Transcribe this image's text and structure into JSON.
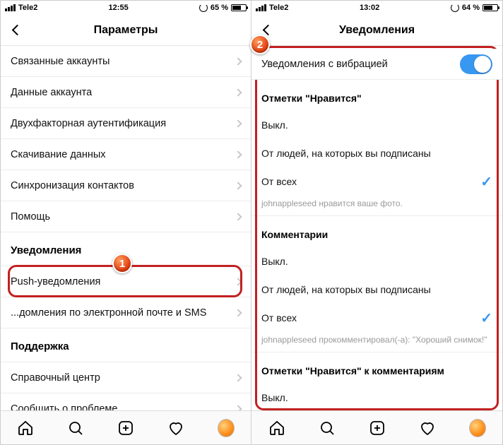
{
  "left": {
    "status": {
      "carrier": "Tele2",
      "time": "12:55",
      "battery": "65 %"
    },
    "nav_title": "Параметры",
    "rows": [
      "Связанные аккаунты",
      "Данные аккаунта",
      "Двухфакторная аутентификация",
      "Скачивание данных",
      "Синхронизация контактов",
      "Помощь"
    ],
    "section_notifications": "Уведомления",
    "push_row": "Push-уведомления",
    "email_sms_row": "...домления по электронной почте и SMS",
    "section_support": "Поддержка",
    "support_rows": [
      "Справочный центр",
      "Сообщить о проблеме"
    ]
  },
  "right": {
    "status": {
      "carrier": "Tele2",
      "time": "13:02",
      "battery": "64 %"
    },
    "nav_title": "Уведомления",
    "vibrate_row": "Уведомления с вибрацией",
    "likes_head": "Отметки \"Нравится\"",
    "opts": [
      "Выкл.",
      "От людей, на которых вы подписаны",
      "От всех"
    ],
    "likes_hint": "johnappleseed нравится ваше фото.",
    "comments_head": "Комментарии",
    "comments_hint": "johnappleseed прокомментировал(-а): \"Хороший снимок!\"",
    "comment_likes_head": "Отметки \"Нравится\" к комментариям",
    "off": "Выкл."
  },
  "badges": {
    "one": "1",
    "two": "2"
  }
}
